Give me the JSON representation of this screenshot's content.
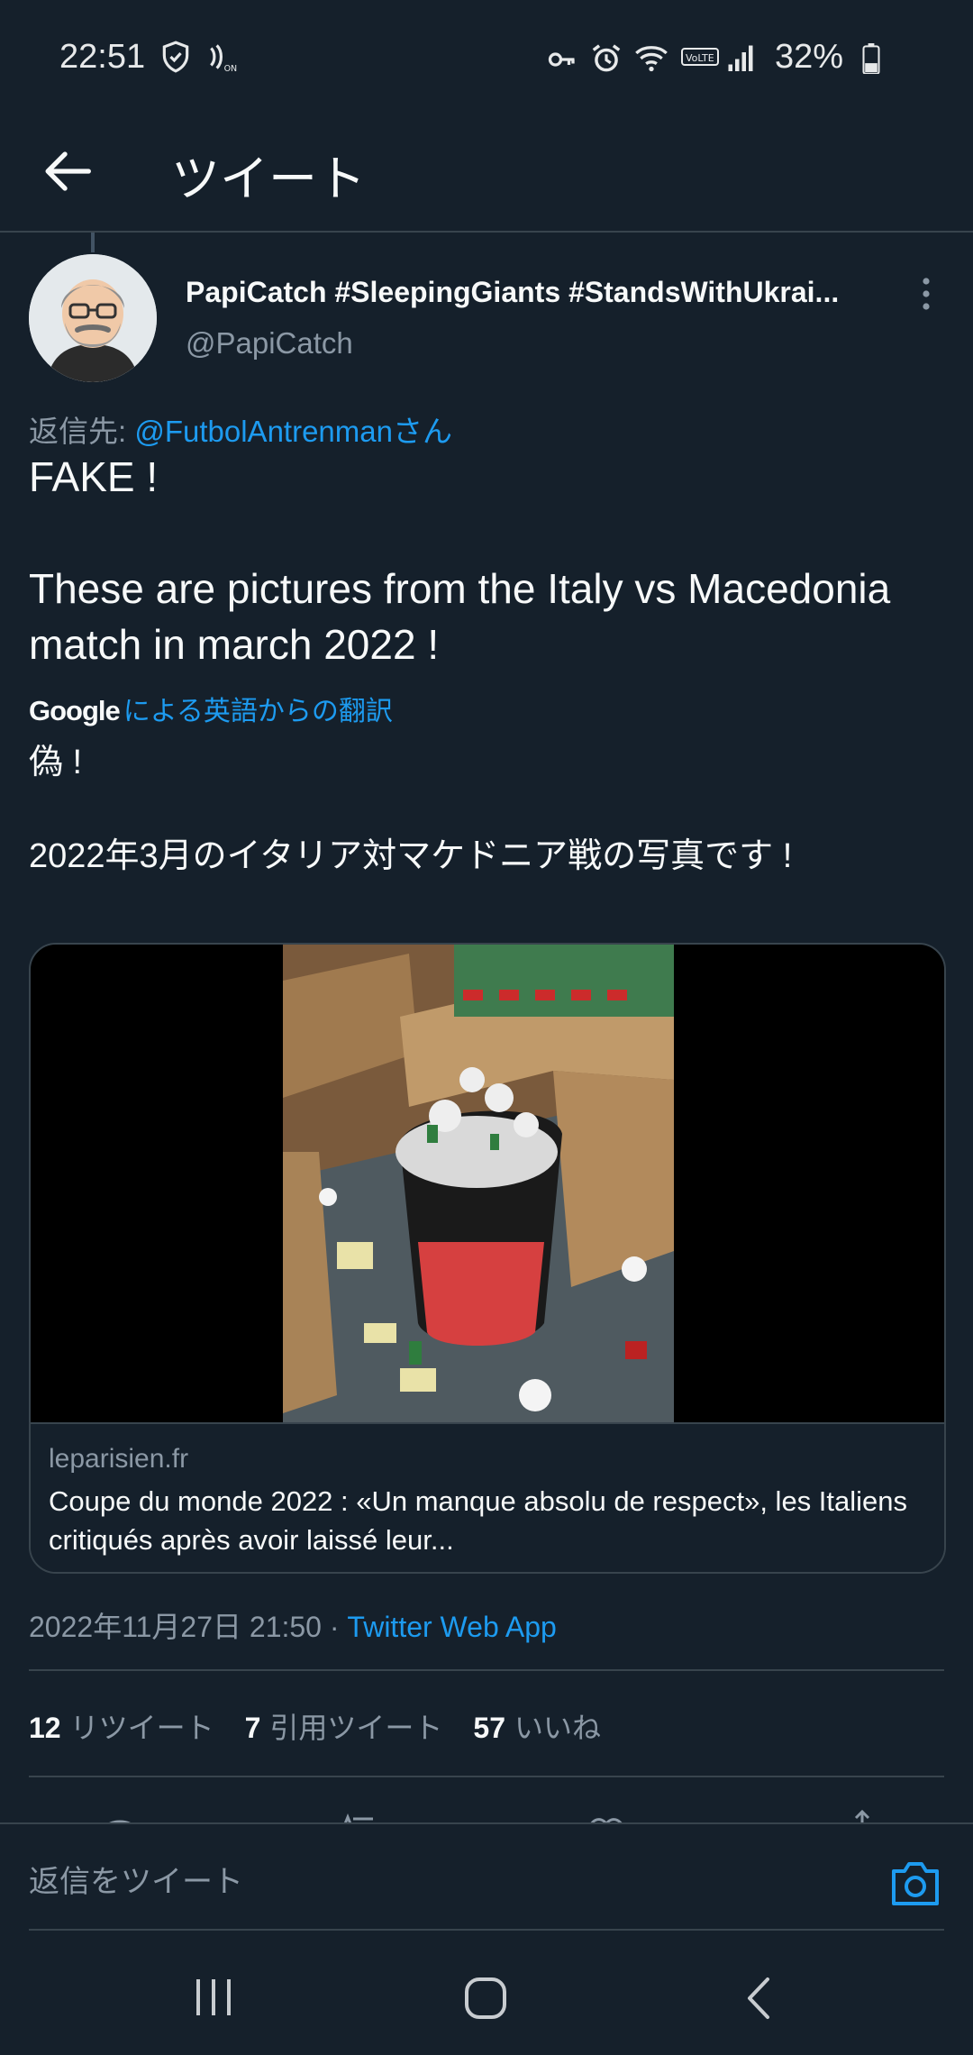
{
  "status_bar": {
    "time": "22:51",
    "battery_percent": "32%",
    "icons_left": [
      "shield-icon",
      "nfc-icon"
    ],
    "icons_right": [
      "key-icon",
      "alarm-icon",
      "wifi-icon",
      "volte-icon",
      "signal-icon",
      "battery-icon"
    ]
  },
  "header": {
    "title": "ツイート"
  },
  "tweet": {
    "author_name": "PapiCatch #SleepingGiants #StandsWithUkrai...",
    "author_handle": "@PapiCatch",
    "reply_prefix": "返信先: ",
    "reply_mention": "@FutbolAntrenmanさん",
    "text": "FAKE !\n\nThese are pictures from the Italy vs Macedonia match in march 2022 !",
    "translation_brand": "Google",
    "translation_label": "による英語からの翻訳",
    "translated_text": "偽 !\n\n2022年3月のイタリア対マケドニア戦の写真です !",
    "card": {
      "domain": "leparisien.fr",
      "title": "Coupe du monde 2022 : «Un manque absolu de respect», les Italiens critiqués après avoir laissé leur..."
    },
    "timestamp": "2022年11月27日 21:50",
    "separator": " · ",
    "client": "Twitter Web App",
    "stats": [
      {
        "count": "12",
        "label": "リツイート"
      },
      {
        "count": "7",
        "label": "引用ツイート"
      },
      {
        "count": "57",
        "label": "いいね"
      }
    ]
  },
  "reply_bar": {
    "placeholder": "返信をツイート"
  },
  "colors": {
    "background": "#15202b",
    "accent": "#1d9bf0",
    "secondary_text": "#8b98a5",
    "divider": "#38444d"
  }
}
